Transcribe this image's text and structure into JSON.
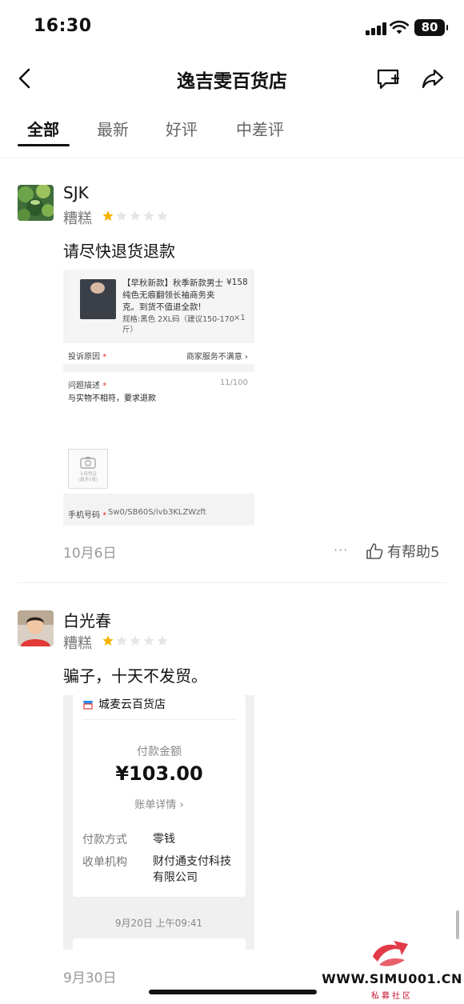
{
  "status_bar": {
    "time": "16:30",
    "battery": "80"
  },
  "nav": {
    "title": "逸吉雯百货店"
  },
  "tabs": [
    {
      "label": "全部",
      "active": true
    },
    {
      "label": "最新",
      "active": false
    },
    {
      "label": "好评",
      "active": false
    },
    {
      "label": "中差评",
      "active": false
    }
  ],
  "reviews": [
    {
      "username": "SJK",
      "rating_label": "糟糕",
      "stars": 1,
      "text": "请尽快退货退款",
      "date": "10月6日",
      "helpful_label": "有帮助",
      "helpful_count": "5",
      "more": "···",
      "screenshot": {
        "product_title": "【早秋新款】秋季新款男士纯色无痕翻领长袖商务夹克。到货不值退全款!",
        "price": "¥158",
        "spec": "规格:黑色 2XL码（建议150-170斤）",
        "qty": "×1",
        "reason_label": "投诉原因",
        "reason_value": "商家服务不满意",
        "desc_label": "问题描述",
        "desc_count": "11/100",
        "desc_text": "与实物不相符，要求退款",
        "upload_label": "上传凭证",
        "upload_sub": "(最多5张)",
        "phone_label": "手机号码",
        "phone_value": "Sw0/SB60S/ivb3KLZWzft"
      }
    },
    {
      "username": "白光春",
      "rating_label": "糟糕",
      "stars": 1,
      "text": "骗子，十天不发贸。",
      "date": "9月30日",
      "screenshot": {
        "store": "城麦云百货店",
        "pay_label": "付款金额",
        "amount": "¥103.00",
        "detail": "账单详情 ›",
        "method_label": "付款方式",
        "method_value": "零钱",
        "org_label": "收单机构",
        "org_value_1": "财付通支付科技",
        "org_value_2": "有限公司",
        "time": "9月20日 上午09:41"
      }
    }
  ],
  "watermark": {
    "url": "WWW.SIMU001.CN",
    "sub": "私募社区"
  },
  "colors": {
    "star_filled": "#f5b400",
    "star_empty": "#e6e6e6",
    "accent_red": "#e02e24"
  }
}
